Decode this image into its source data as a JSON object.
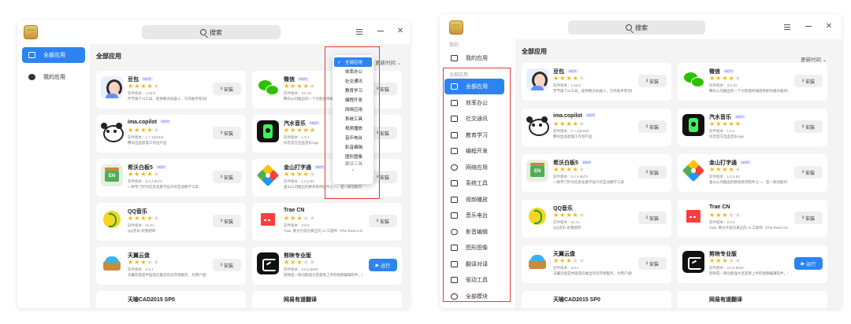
{
  "left_window": {
    "search_placeholder": "搜索",
    "sidebar": [
      {
        "label": "全部应用",
        "icon": "monitor-icon",
        "active": true
      },
      {
        "label": "我的应用",
        "icon": "box-icon",
        "active": false
      }
    ],
    "title": "全部应用",
    "sort_label": "更新时间",
    "dropdown": {
      "items": [
        "全部应用",
        "效率办公",
        "社交通讯",
        "教育学习",
        "编程开发",
        "网络应用",
        "系统工具",
        "视频播放",
        "音乐电台",
        "影音编辑",
        "图形图像"
      ],
      "partial": "翻译工具",
      "selected": "全部应用",
      "more": "⌄"
    },
    "cards": [
      {
        "name": "豆包",
        "badge": "HOT",
        "stars": 4,
        "version": "软件版本：1.53.0",
        "desc": "字节旗下AI工具，提供聊天机器人、写作助手等功能",
        "button": "安装",
        "icon": "doubao-icon"
      },
      {
        "name": "微信",
        "badge": "HOT",
        "stars": 4,
        "version": "软件版本：3.8.10",
        "desc": "腾讯公司推出的一个为智能终端提供即时通讯服务的免费应用程序",
        "button": "安装",
        "icon": "wechat-icon"
      },
      {
        "name": "ima.copilot",
        "badge": "HOT",
        "stars": 4,
        "version": "软件版本：1.7.1(5440)",
        "desc": "腾讯出品智能工作台产品",
        "button": "安装",
        "icon": "ima-icon"
      },
      {
        "name": "汽水音乐",
        "badge": "HOT",
        "stars": 5,
        "version": "软件版本：1.0.1",
        "desc": "抖音官方出品音乐App",
        "button": "安装",
        "icon": "qishui-icon"
      },
      {
        "name": "希沃白板5",
        "badge": "HOT",
        "stars": 4,
        "version": "软件版本：5.2.4.8673",
        "desc": "一款专门针对信息化教学设计的互动教学工具",
        "button": "安装",
        "icon": "kx-icon"
      },
      {
        "name": "金山打字通",
        "badge": "HOT",
        "stars": 4,
        "version": "软件版本：1.0.3.93",
        "desc": "金山公司推出的教育系列软件之一，是一款功能齐全、数据丰富、界面友好的打字练习软件",
        "button": "安装",
        "icon": "jinshan-icon"
      },
      {
        "name": "QQ音乐",
        "badge": "",
        "stars": 4,
        "version": "软件版本：11.31",
        "desc": "QQ音乐·听我想听",
        "button": "安装",
        "icon": "qqmusic-icon"
      },
      {
        "name": "Trae CN",
        "badge": "",
        "stars": 3,
        "version": "软件版本：0.8.0",
        "desc": "Trae, 致力于成为真正的 AI 工程师（The Real AI Engineer）",
        "button": "安装",
        "icon": "trae-icon"
      },
      {
        "name": "天翼云盘",
        "badge": "",
        "stars": 3,
        "version": "软件版本：6.9.1",
        "desc": "天翼云盘是中国电信推出的云存储服务，为用户提供跨平台的文件存储、备份、同步及分享服务",
        "button": "安装",
        "icon": "tianyi-icon"
      },
      {
        "name": "剪映专业版",
        "badge": "",
        "stars": 3,
        "version": "软件版本：3.6.5.8940",
        "desc": "剪映是一款功能强大且容易上手的视频编辑软件，剪映PC版...",
        "button": "运行",
        "icon": "capcut-icon"
      },
      {
        "name": "天喻CAD2015 SP0",
        "badge": "",
        "stars": 0,
        "version": "",
        "desc": "",
        "button": "",
        "icon": ""
      },
      {
        "name": "网易有道翻译",
        "badge": "",
        "stars": 0,
        "version": "",
        "desc": "",
        "button": "",
        "icon": ""
      }
    ]
  },
  "right_window": {
    "search_placeholder": "搜索",
    "group_mine": "我的",
    "mine_item": {
      "label": "我的应用",
      "icon": "grid-icon"
    },
    "group_all": "全部应用",
    "sidebar": [
      {
        "label": "全部应用",
        "icon": "monitor-icon",
        "active": true
      },
      {
        "label": "效率办公",
        "icon": "briefcase-icon",
        "active": false
      },
      {
        "label": "社交通讯",
        "icon": "mail-icon",
        "active": false
      },
      {
        "label": "教育学习",
        "icon": "book-icon",
        "active": false
      },
      {
        "label": "编程开发",
        "icon": "code-icon",
        "active": false
      },
      {
        "label": "网络应用",
        "icon": "globe-icon",
        "active": false
      },
      {
        "label": "系统工具",
        "icon": "toolbox-icon",
        "active": false
      },
      {
        "label": "视频播放",
        "icon": "video-icon",
        "active": false
      },
      {
        "label": "音乐电台",
        "icon": "music-icon",
        "active": false
      },
      {
        "label": "影音编辑",
        "icon": "media-edit-icon",
        "active": false
      },
      {
        "label": "图形图像",
        "icon": "image-icon",
        "active": false
      },
      {
        "label": "翻译对译",
        "icon": "translate-icon",
        "active": false
      },
      {
        "label": "驱动工具",
        "icon": "driver-icon",
        "active": false
      },
      {
        "label": "全部模块",
        "icon": "modules-icon",
        "active": false
      }
    ],
    "title": "全部应用",
    "sort_label": "更新时间"
  },
  "colors": {
    "accent": "#2b84f1",
    "annotation": "#e53935",
    "star": "#f6b400"
  }
}
